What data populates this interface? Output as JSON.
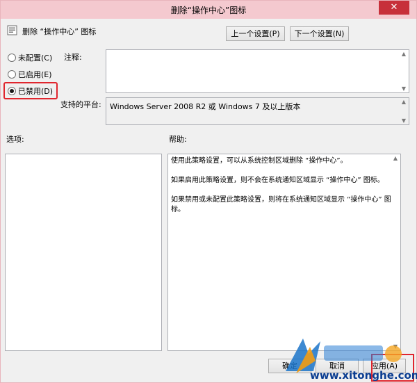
{
  "window": {
    "title": "删除“操作中心”图标",
    "close_glyph": "✕"
  },
  "header": {
    "title": "删除 “操作中心” 图标",
    "prev_label": "上一个设置(P)",
    "next_label": "下一个设置(N)"
  },
  "state": {
    "options": [
      {
        "label": "未配置(C)",
        "checked": false
      },
      {
        "label": "已启用(E)",
        "checked": false
      },
      {
        "label": "已禁用(D)",
        "checked": true
      }
    ]
  },
  "comment": {
    "label": "注释:",
    "value": ""
  },
  "platform": {
    "label": "支持的平台:",
    "value": "Windows Server 2008 R2 或 Windows 7 及以上版本"
  },
  "options_section": {
    "label": "选项:"
  },
  "help_section": {
    "label": "帮助:",
    "paragraphs": [
      "使用此策略设置，可以从系统控制区域删除 “操作中心”。",
      "如果启用此策略设置，则不会在系统通知区域显示 “操作中心” 图标。",
      "如果禁用或未配置此策略设置，则将在系统通知区域显示 “操作中心” 图标。"
    ]
  },
  "footer": {
    "ok_label": "确定",
    "cancel_label": "取消",
    "apply_label": "应用(A)"
  },
  "watermark": {
    "site": "www.xitonghe.com"
  },
  "colors": {
    "titlebar": "#f4c9cf",
    "highlight": "#e0262e",
    "close": "#c7303a"
  }
}
